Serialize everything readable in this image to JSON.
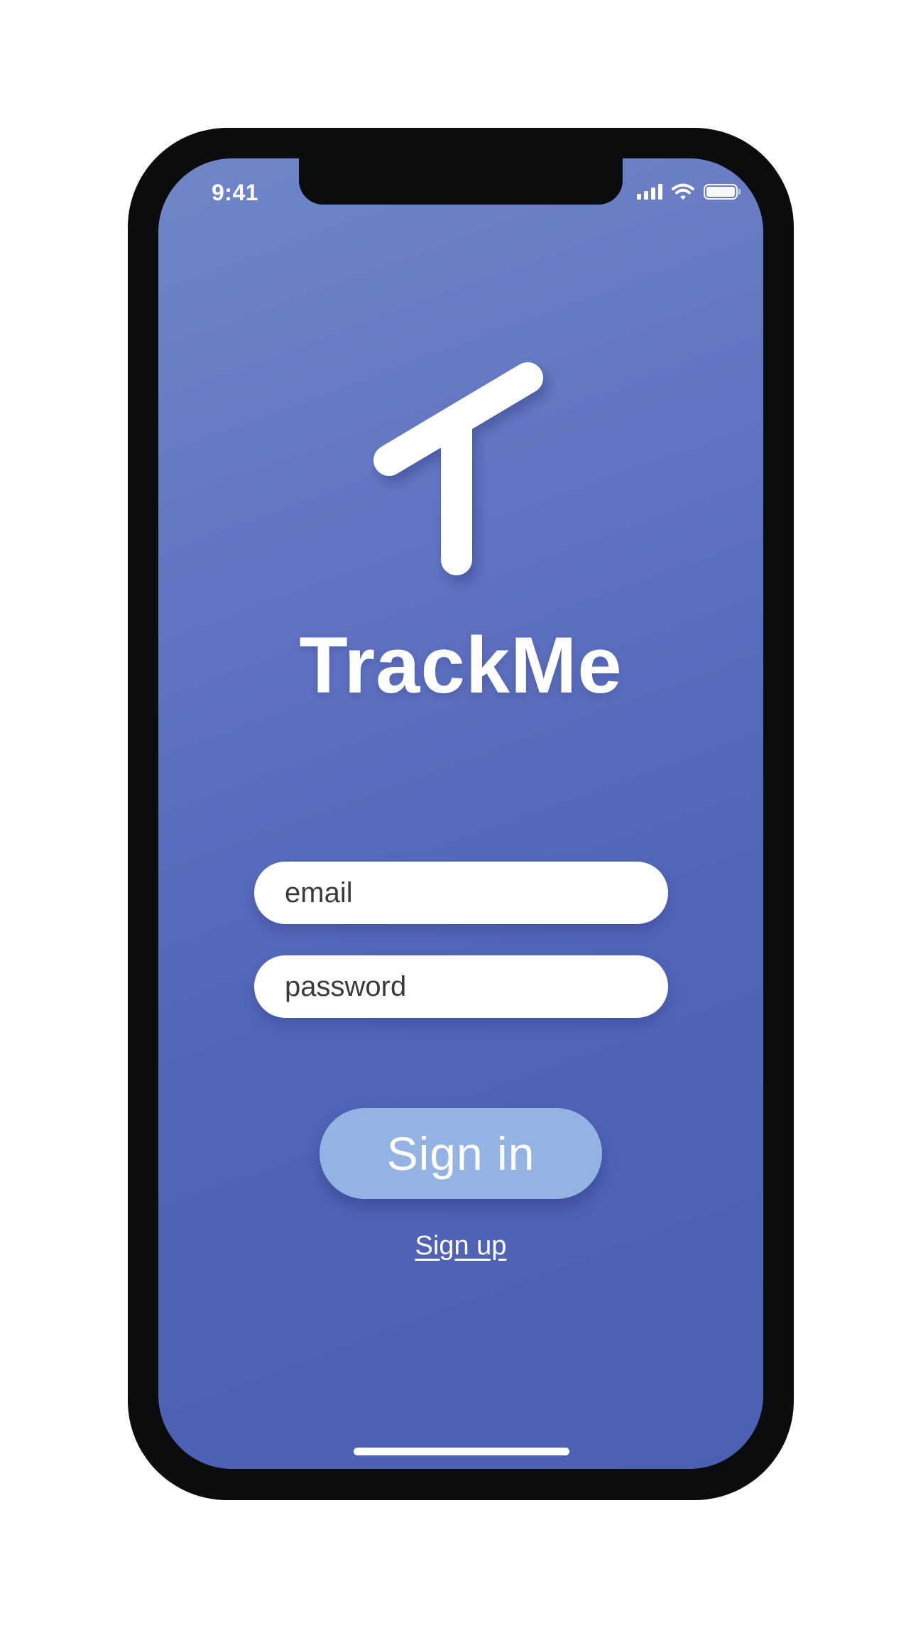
{
  "status_bar": {
    "time": "9:41",
    "icons": [
      "signal-icon",
      "wifi-icon",
      "battery-icon"
    ]
  },
  "app": {
    "logo_icon": "t-logo-icon",
    "title": "TrackMe"
  },
  "form": {
    "email": {
      "value": "",
      "placeholder": "email"
    },
    "password": {
      "value": "",
      "placeholder": "password"
    },
    "signin_label": "Sign in",
    "signup_label": "Sign up"
  },
  "colors": {
    "gradient_start": "#7186c8",
    "gradient_end": "#4b5fb3",
    "button_bg": "#93b3e3",
    "frame": "#0b0c0d",
    "text_on_accent": "#ffffff"
  }
}
